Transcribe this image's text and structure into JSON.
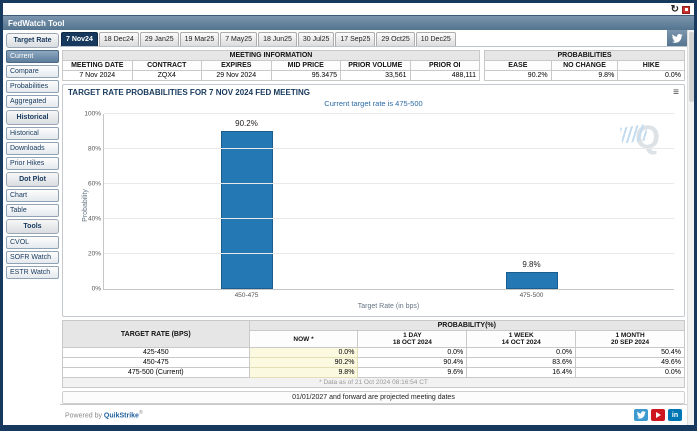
{
  "window": {
    "title": "FedWatch Tool"
  },
  "icons": {
    "refresh_glyph": "↻",
    "chart_menu_glyph": "≡",
    "watermark_letter": "Q"
  },
  "sidebar": {
    "sections": [
      {
        "header": "Target Rate",
        "items": [
          {
            "label": "Current",
            "selected": true
          },
          {
            "label": "Compare",
            "selected": false
          },
          {
            "label": "Probabilities",
            "selected": false
          },
          {
            "label": "Aggregated",
            "selected": false
          }
        ]
      },
      {
        "header": "Historical",
        "items": [
          {
            "label": "Historical",
            "selected": false
          },
          {
            "label": "Downloads",
            "selected": false
          },
          {
            "label": "Prior Hikes",
            "selected": false
          }
        ]
      },
      {
        "header": "Dot Plot",
        "items": [
          {
            "label": "Chart",
            "selected": false
          },
          {
            "label": "Table",
            "selected": false
          }
        ]
      },
      {
        "header": "Tools",
        "items": [
          {
            "label": "CVOL",
            "selected": false
          },
          {
            "label": "SOFR Watch",
            "selected": false
          },
          {
            "label": "ESTR Watch",
            "selected": false
          }
        ]
      }
    ]
  },
  "tabs": [
    {
      "label": "7 Nov24",
      "selected": true
    },
    {
      "label": "18 Dec24",
      "selected": false
    },
    {
      "label": "29 Jan25",
      "selected": false
    },
    {
      "label": "19 Mar25",
      "selected": false
    },
    {
      "label": "7 May25",
      "selected": false
    },
    {
      "label": "18 Jun25",
      "selected": false
    },
    {
      "label": "30 Jul25",
      "selected": false
    },
    {
      "label": "17 Sep25",
      "selected": false
    },
    {
      "label": "29 Oct25",
      "selected": false
    },
    {
      "label": "10 Dec25",
      "selected": false
    }
  ],
  "meeting_info": {
    "title": "MEETING INFORMATION",
    "columns": [
      "MEETING DATE",
      "CONTRACT",
      "EXPIRES",
      "MID PRICE",
      "PRIOR VOLUME",
      "PRIOR OI"
    ],
    "values": [
      "7 Nov 2024",
      "ZQX4",
      "29 Nov 2024",
      "95.3475",
      "33,561",
      "488,111"
    ]
  },
  "probabilities_summary": {
    "title": "PROBABILITIES",
    "columns": [
      "EASE",
      "NO CHANGE",
      "HIKE"
    ],
    "values": [
      "90.2%",
      "9.8%",
      "0.0%"
    ]
  },
  "chart_data": {
    "type": "bar",
    "title": "TARGET RATE PROBABILITIES FOR 7 NOV 2024 FED MEETING",
    "subtitle": "Current target rate is 475-500",
    "categories": [
      "450-475",
      "475-500"
    ],
    "values": [
      90.2,
      9.8
    ],
    "value_labels": [
      "90.2%",
      "9.8%"
    ],
    "xlabel": "Target Rate (in bps)",
    "ylabel": "Probability",
    "ylim": [
      0,
      100
    ],
    "yticks": [
      0,
      20,
      40,
      60,
      80,
      100
    ],
    "ytick_suffix": "%",
    "bar_color": "#2478b4",
    "grid": true,
    "legend": "none"
  },
  "history_table": {
    "rate_header": "TARGET RATE (BPS)",
    "group_header": "PROBABILITY(%)",
    "columns": [
      {
        "l1": "NOW *",
        "l2": ""
      },
      {
        "l1": "1 DAY",
        "l2": "18 OCT 2024"
      },
      {
        "l1": "1 WEEK",
        "l2": "14 OCT 2024"
      },
      {
        "l1": "1 MONTH",
        "l2": "20 SEP 2024"
      }
    ],
    "rows": [
      {
        "rate": "425-450",
        "cells": [
          "0.0%",
          "0.0%",
          "0.0%",
          "50.4%"
        ]
      },
      {
        "rate": "450-475",
        "cells": [
          "90.2%",
          "90.4%",
          "83.6%",
          "49.6%"
        ]
      },
      {
        "rate": "475-500 (Current)",
        "cells": [
          "9.8%",
          "9.6%",
          "16.4%",
          "0.0%"
        ]
      }
    ],
    "footnote": "* Data as of 21 Oct 2024 08:16:54 CT"
  },
  "footer": {
    "projection_note": "01/01/2027 and forward are projected meeting dates",
    "powered_prefix": "Powered by ",
    "brand": "QuikStrike",
    "reg_mark": "®",
    "social": [
      "twitter",
      "youtube",
      "linkedin"
    ]
  }
}
